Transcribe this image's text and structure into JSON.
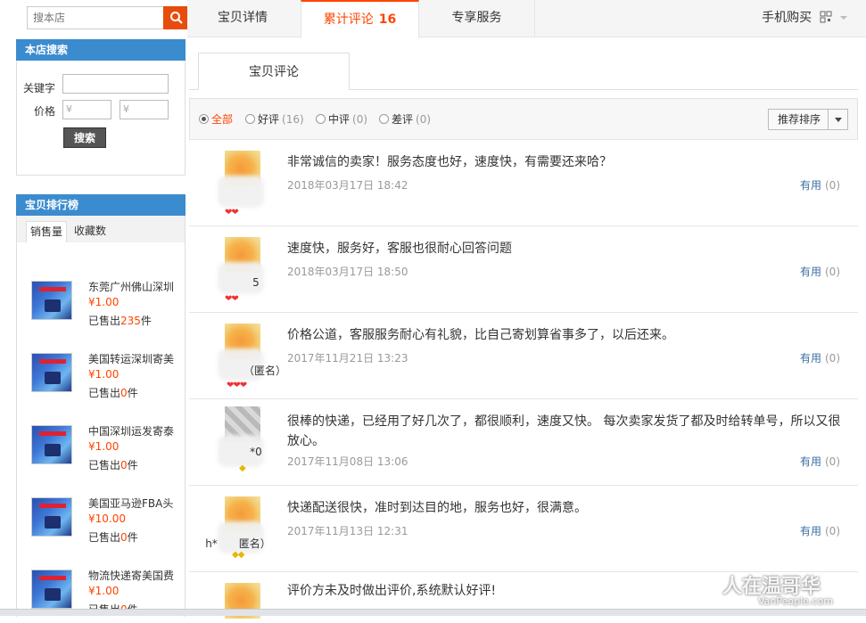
{
  "shop_search": {
    "placeholder": "搜本店"
  },
  "store_search": {
    "title": "本店搜索",
    "keyword_label": "关键字",
    "price_label": "价格",
    "price_min_placeholder": "¥",
    "price_max_placeholder": "¥",
    "search_button": "搜索"
  },
  "ranking": {
    "title": "宝贝排行榜",
    "tabs": [
      "销售量",
      "收藏数"
    ],
    "active_tab": 0,
    "items": [
      {
        "name": "东莞广州佛山深圳",
        "price": "¥1.00",
        "sold_prefix": "已售出",
        "sold": "235",
        "sold_suffix": "件"
      },
      {
        "name": "美国转运深圳寄美",
        "price": "¥1.00",
        "sold_prefix": "已售出",
        "sold": "0",
        "sold_suffix": "件"
      },
      {
        "name": "中国深圳运发寄泰",
        "price": "¥1.00",
        "sold_prefix": "已售出",
        "sold": "0",
        "sold_suffix": "件"
      },
      {
        "name": "美国亚马逊FBA头",
        "price": "¥10.00",
        "sold_prefix": "已售出",
        "sold": "0",
        "sold_suffix": "件"
      },
      {
        "name": "物流快递寄美国费",
        "price": "¥1.00",
        "sold_prefix": "已售出",
        "sold": "0",
        "sold_suffix": "件"
      }
    ]
  },
  "top_tabs": {
    "detail": "宝贝详情",
    "reviews": "累计评论",
    "reviews_count": "16",
    "service": "专享服务",
    "mobile_buy": "手机购买"
  },
  "sub_tab": "宝贝评论",
  "filter": {
    "options": [
      {
        "label": "全部",
        "count": ""
      },
      {
        "label": "好评",
        "count": "(16)"
      },
      {
        "label": "中评",
        "count": "(0)"
      },
      {
        "label": "差评",
        "count": "(0)"
      }
    ],
    "selected": 0,
    "sort_label": "推荐排序"
  },
  "reviews": [
    {
      "text": "非常诚信的卖家！服务态度也好，速度快，有需要还来哈？",
      "time": "2018年03月17日 18:42",
      "nick": "",
      "badge": "❤❤",
      "useful": "有用",
      "useful_count": "(0)"
    },
    {
      "text": "速度快，服务好，客服也很耐心回答问题",
      "time": "2018年03月17日 18:50",
      "nick": "5",
      "badge": "❤❤",
      "useful": "有用",
      "useful_count": "(0)"
    },
    {
      "text": "价格公道，客服服务耐心有礼貌，比自己寄划算省事多了，以后还来。",
      "time": "2017年11月21日 13:23",
      "nick": "（匿名）",
      "badge": "❤❤❤",
      "useful": "有用",
      "useful_count": "(0)"
    },
    {
      "text": "很棒的快递，已经用了好几次了，都很顺利，速度又快。 每次卖家发货了都及时给转单号，所以又很放心。",
      "time": "2017年11月08日 13:06",
      "nick": "*0",
      "badge": "◆",
      "useful": "有用",
      "useful_count": "(0)"
    },
    {
      "text": "快递配送很快，准时到达目的地，服务也好，很满意。",
      "time": "2017年11月13日 12:31",
      "nick": "h*　　匿名）",
      "badge": "◆◆",
      "useful": "有用",
      "useful_count": "(0)"
    },
    {
      "text": "评价方未及时做出评价,系统默认好评!",
      "time": "",
      "nick": "",
      "badge": "",
      "useful": "",
      "useful_count": ""
    }
  ],
  "watermark": {
    "main": "人在温哥华",
    "sub": "VanPeople.com"
  }
}
